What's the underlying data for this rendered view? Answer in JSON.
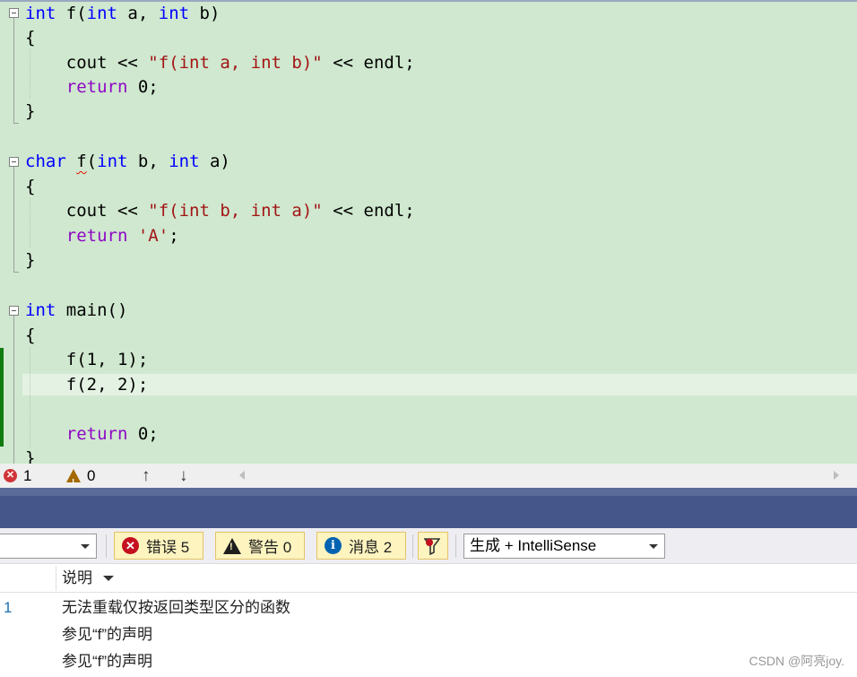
{
  "editor": {
    "lines": [
      {
        "name": "line-int-f-ab",
        "segments": [
          {
            "t": "int",
            "c": "kw"
          },
          {
            "t": " f(",
            "c": "plain"
          },
          {
            "t": "int",
            "c": "kw"
          },
          {
            "t": " a, ",
            "c": "plain"
          },
          {
            "t": "int",
            "c": "kw"
          },
          {
            "t": " b)",
            "c": "plain"
          }
        ]
      },
      {
        "name": "line-brace-open-1",
        "segments": [
          {
            "t": "{",
            "c": "plain"
          }
        ]
      },
      {
        "name": "line-cout-1",
        "segments": [
          {
            "t": "    cout << ",
            "c": "plain"
          },
          {
            "t": "\"f(int a, int b)\"",
            "c": "str"
          },
          {
            "t": " << endl;",
            "c": "plain"
          }
        ]
      },
      {
        "name": "line-return-1",
        "segments": [
          {
            "t": "    ",
            "c": "plain"
          },
          {
            "t": "return",
            "c": "kw2"
          },
          {
            "t": " 0;",
            "c": "plain"
          }
        ]
      },
      {
        "name": "line-brace-close-1",
        "segments": [
          {
            "t": "}",
            "c": "plain"
          }
        ]
      },
      {
        "name": "line-blank-1",
        "segments": []
      },
      {
        "name": "line-char-f-ba",
        "segments": [
          {
            "t": "char",
            "c": "kw"
          },
          {
            "t": " ",
            "c": "plain"
          },
          {
            "t": "f",
            "c": "squig"
          },
          {
            "t": "(",
            "c": "plain"
          },
          {
            "t": "int",
            "c": "kw"
          },
          {
            "t": " b, ",
            "c": "plain"
          },
          {
            "t": "int",
            "c": "kw"
          },
          {
            "t": " a)",
            "c": "plain"
          }
        ]
      },
      {
        "name": "line-brace-open-2",
        "segments": [
          {
            "t": "{",
            "c": "plain"
          }
        ]
      },
      {
        "name": "line-cout-2",
        "segments": [
          {
            "t": "    cout << ",
            "c": "plain"
          },
          {
            "t": "\"f(int b, int a)\"",
            "c": "str"
          },
          {
            "t": " << endl;",
            "c": "plain"
          }
        ]
      },
      {
        "name": "line-return-2",
        "segments": [
          {
            "t": "    ",
            "c": "plain"
          },
          {
            "t": "return",
            "c": "kw2"
          },
          {
            "t": " ",
            "c": "plain"
          },
          {
            "t": "'A'",
            "c": "str"
          },
          {
            "t": ";",
            "c": "plain"
          }
        ]
      },
      {
        "name": "line-brace-close-2",
        "segments": [
          {
            "t": "}",
            "c": "plain"
          }
        ]
      },
      {
        "name": "line-blank-2",
        "segments": []
      },
      {
        "name": "line-int-main",
        "segments": [
          {
            "t": "int",
            "c": "kw"
          },
          {
            "t": " main()",
            "c": "plain"
          }
        ]
      },
      {
        "name": "line-brace-open-3",
        "segments": [
          {
            "t": "{",
            "c": "plain"
          }
        ]
      },
      {
        "name": "line-call-1",
        "segments": [
          {
            "t": "    f(1, 1);",
            "c": "plain"
          }
        ]
      },
      {
        "name": "line-call-2",
        "segments": [
          {
            "t": "    f(2, 2);",
            "c": "plain"
          }
        ]
      },
      {
        "name": "line-blank-3",
        "segments": []
      },
      {
        "name": "line-return-3",
        "segments": [
          {
            "t": "    ",
            "c": "plain"
          },
          {
            "t": "return",
            "c": "kw2"
          },
          {
            "t": " 0;",
            "c": "plain"
          }
        ]
      },
      {
        "name": "line-brace-close-3",
        "segments": [
          {
            "t": "}",
            "c": "plain"
          }
        ]
      }
    ]
  },
  "status": {
    "errors": "1",
    "warnings": "0",
    "up": "↑",
    "down": "↓"
  },
  "toolbar": {
    "errors_label": "错误 5",
    "warnings_label": "警告 0",
    "messages_label": "消息 2",
    "source_combo": "生成 + IntelliSense"
  },
  "error_list": {
    "column_header": "说明",
    "rows": [
      {
        "num": "1",
        "desc": "无法重载仅按返回类型区分的函数"
      },
      {
        "num": "",
        "desc": "参见“f”的声明"
      },
      {
        "num": "",
        "desc": "参见“f”的声明"
      }
    ]
  },
  "watermark": "CSDN @阿亮joy."
}
